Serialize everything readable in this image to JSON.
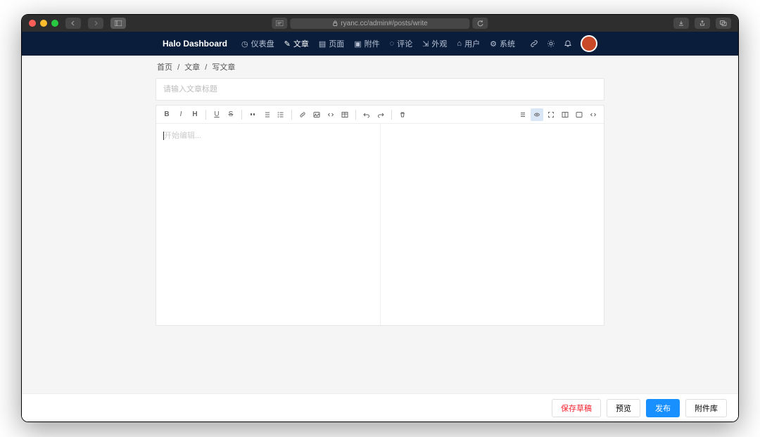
{
  "browser": {
    "url": "ryanc.cc/admin#/posts/write",
    "secure": true
  },
  "brand": "Halo Dashboard",
  "nav": [
    {
      "label": "仪表盘",
      "icon": "dashboard",
      "active": false
    },
    {
      "label": "文章",
      "icon": "edit",
      "active": true
    },
    {
      "label": "页面",
      "icon": "page",
      "active": false
    },
    {
      "label": "附件",
      "icon": "attach",
      "active": false
    },
    {
      "label": "评论",
      "icon": "comment",
      "active": false
    },
    {
      "label": "外观",
      "icon": "skin",
      "active": false
    },
    {
      "label": "用户",
      "icon": "user",
      "active": false
    },
    {
      "label": "系统",
      "icon": "settings",
      "active": false
    }
  ],
  "breadcrumb": {
    "home": "首页",
    "section": "文章",
    "page": "写文章"
  },
  "title_placeholder": "请输入文章标题",
  "title_value": "",
  "editor": {
    "placeholder": "开始编辑...",
    "value": ""
  },
  "footer": {
    "save_draft": "保存草稿",
    "preview": "预览",
    "publish": "发布",
    "attachments": "附件库"
  }
}
